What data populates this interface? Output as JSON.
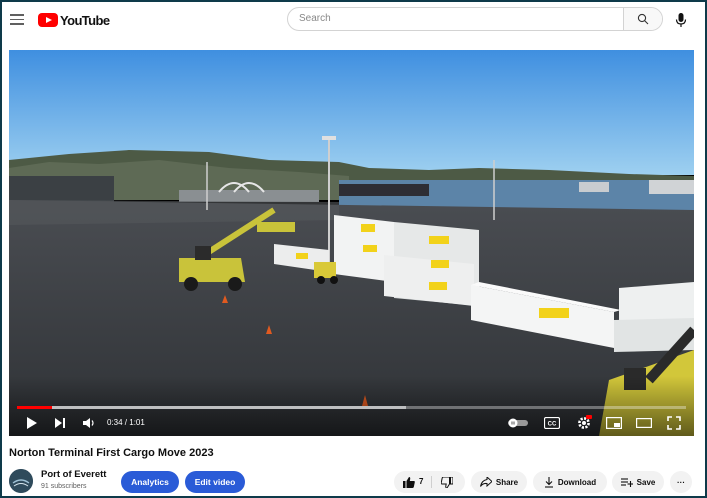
{
  "header": {
    "logo_text": "YouTube",
    "search_placeholder": "Search"
  },
  "player": {
    "time_display": "0:34 / 1:01",
    "progress_fraction": 0.052,
    "buffer_fraction": 0.581,
    "accent_color": "#ff0000",
    "controls": [
      "play-icon",
      "next-icon",
      "volume-icon",
      "autoplay-toggle",
      "captions-icon",
      "settings-icon",
      "miniplayer-icon",
      "theater-icon",
      "fullscreen-icon"
    ],
    "scene": {
      "container_labels": [
        "T.S.RUNT",
        "T.S.RUNT",
        "T.S.RUNT",
        "T.S.RUNT",
        "T.S.RUNT"
      ]
    }
  },
  "video": {
    "title": "Norton Terminal First Cargo Move 2023"
  },
  "channel": {
    "name": "Port of Everett",
    "subscribers": "91 subscribers"
  },
  "actions": {
    "analytics_label": "Analytics",
    "edit_label": "Edit video",
    "like_count": "7",
    "share_label": "Share",
    "download_label": "Download",
    "save_label": "Save",
    "more_label": "···"
  },
  "colors": {
    "brand_red": "#ff0000",
    "studio_blue": "#2a5bd7"
  }
}
